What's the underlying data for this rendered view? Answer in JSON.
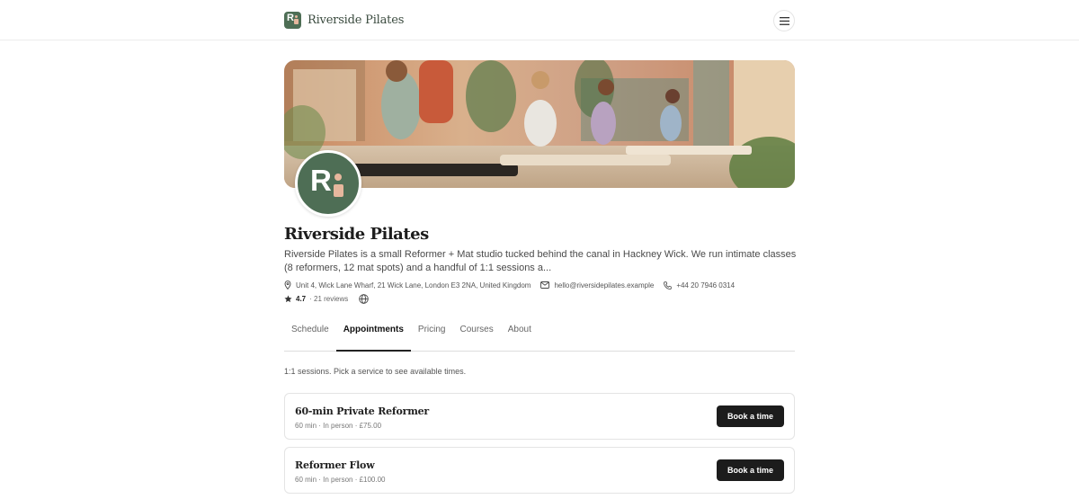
{
  "header": {
    "brand_name": "Riverside Pilates",
    "logo_letter": "R",
    "menu_icon": "hamburger-icon"
  },
  "hero": {
    "image": "studio-photo"
  },
  "studio": {
    "avatar_letter": "R",
    "name": "Riverside Pilates",
    "description": "Riverside Pilates is a small Reformer + Mat studio tucked behind the canal in Hackney Wick. We run intimate classes (8 reformers, 12 mat spots) and a handful of 1:1 sessions a...",
    "address": "Unit 4, Wick Lane Wharf, 21 Wick Lane, London E3 2NA, United Kingdom",
    "email": "hello@riversidepilates.example",
    "phone": "+44 20 7946 0314",
    "rating": "4.7",
    "reviews": "· 21 reviews"
  },
  "tabs": [
    {
      "label": "Schedule",
      "active": false
    },
    {
      "label": "Appointments",
      "active": true
    },
    {
      "label": "Pricing",
      "active": false
    },
    {
      "label": "Courses",
      "active": false
    },
    {
      "label": "About",
      "active": false
    }
  ],
  "appointments": {
    "intro": "1:1 sessions. Pick a service to see available times.",
    "services": [
      {
        "title": "60-min Private Reformer",
        "meta": "60 min · In person · £75.00",
        "button": "Book a time"
      },
      {
        "title": "Reformer Flow",
        "meta": "60 min · In person · £100.00",
        "button": "Book a time"
      }
    ]
  },
  "colors": {
    "brand_green": "#4e6e55",
    "accent_peach": "#e6b79d",
    "button_dark": "#1c1c1c"
  }
}
